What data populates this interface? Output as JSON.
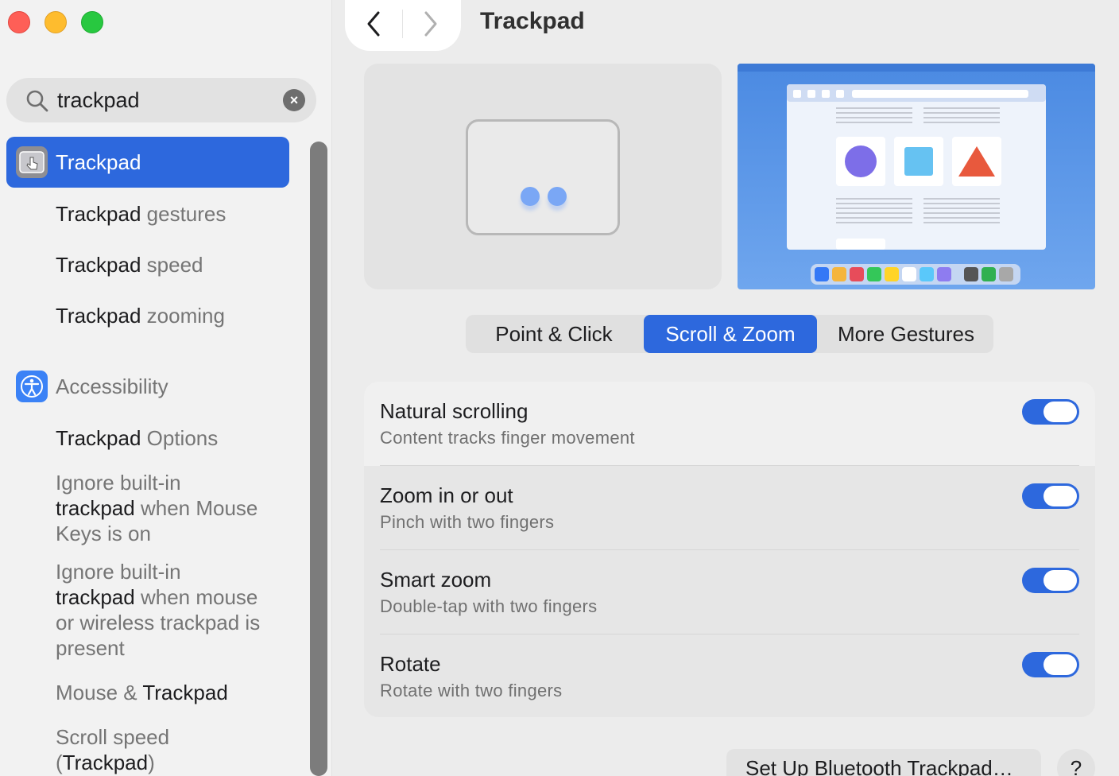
{
  "window": {
    "title": "Trackpad"
  },
  "search": {
    "value": "trackpad",
    "placeholder": "Search"
  },
  "sidebar": {
    "selected": {
      "label": "Trackpad"
    },
    "trackpad_results": [
      {
        "match": "Trackpad",
        "rest": " gestures"
      },
      {
        "match": "Trackpad",
        "rest": " speed"
      },
      {
        "match": "Trackpad",
        "rest": " zooming"
      }
    ],
    "accessibility": {
      "label": "Accessibility",
      "results": {
        "options": {
          "match": "Trackpad",
          "rest": " Options"
        },
        "ignore1": {
          "pre": "Ignore built-in",
          "match": "trackpad",
          "rest1": " when Mouse",
          "rest2": "Keys is on"
        },
        "ignore2": {
          "pre": "Ignore built-in",
          "match": "trackpad",
          "rest1": " when mouse",
          "rest2": "or wireless trackpad is",
          "rest3": "present"
        },
        "mouse": {
          "pre": "Mouse & ",
          "match": "Trackpad"
        },
        "scroll": {
          "pre": "Scroll speed",
          "open": "(",
          "match": "Trackpad",
          "close": ")"
        }
      }
    }
  },
  "tabs": {
    "point_click": "Point & Click",
    "scroll_zoom": "Scroll & Zoom",
    "more_gestures": "More Gestures",
    "active": "Scroll & Zoom"
  },
  "settings": [
    {
      "title": "Natural scrolling",
      "subtitle": "Content tracks finger movement",
      "enabled": true
    },
    {
      "title": "Zoom in or out",
      "subtitle": "Pinch with two fingers",
      "enabled": true
    },
    {
      "title": "Smart zoom",
      "subtitle": "Double-tap with two fingers",
      "enabled": true
    },
    {
      "title": "Rotate",
      "subtitle": "Rotate with two fingers",
      "enabled": true
    }
  ],
  "buttons": {
    "bluetooth": "Set Up Bluetooth Trackpad…",
    "help": "?"
  },
  "colors": {
    "accent": "#2d68dd",
    "sidebar_bg": "#f2f2f2"
  }
}
